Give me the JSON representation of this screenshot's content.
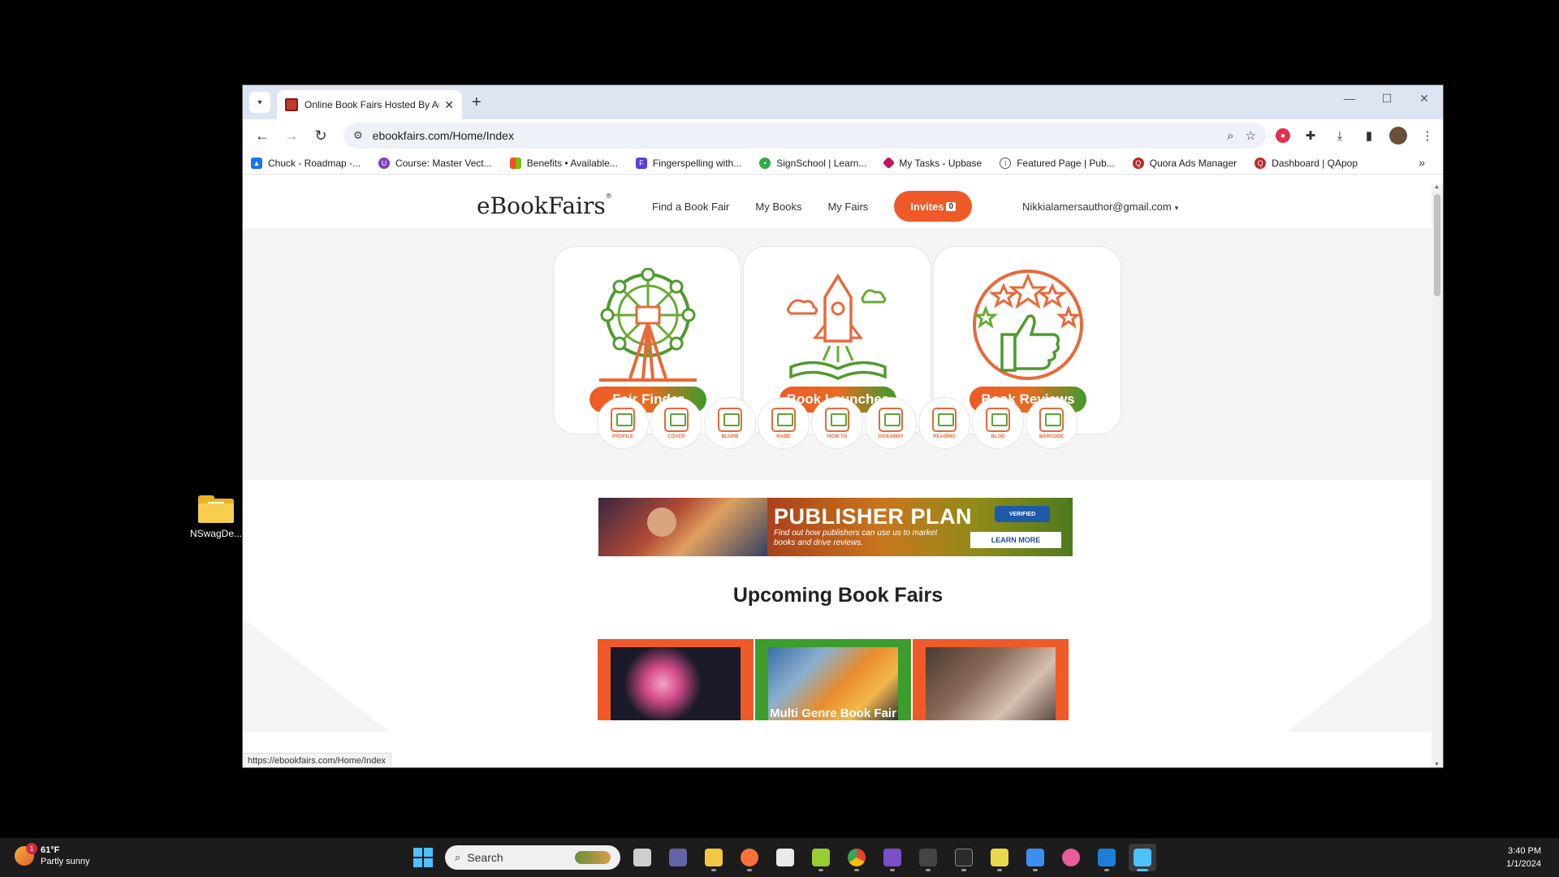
{
  "desktop": {
    "icons": [
      {
        "label": "NSwagDe..."
      }
    ]
  },
  "browser": {
    "tab": {
      "title": "Online Book Fairs Hosted By Au",
      "close": "✕"
    },
    "new_tab": "+",
    "window_controls": {
      "minimize": "—",
      "maximize": "☐",
      "close": "✕"
    },
    "toolbar": {
      "back": "←",
      "forward": "→",
      "reload": "↻"
    },
    "omnibox": {
      "url": "ebookfairs.com/Home/Index"
    },
    "bookmarks": [
      {
        "label": "Chuck - Roadmap -...",
        "icon": "triangle-icon",
        "color": "#1a73e8"
      },
      {
        "label": "Course: Master Vect...",
        "icon": "u-icon",
        "color": "#7b3fbf"
      },
      {
        "label": "Benefits • Available...",
        "icon": "microsoft-icon",
        "color": "#f25022"
      },
      {
        "label": "Fingerspelling with...",
        "icon": "f-icon",
        "color": "#5b3fd9"
      },
      {
        "label": "SignSchool | Learn...",
        "icon": "pin-icon",
        "color": "#2eaa4a"
      },
      {
        "label": "My Tasks - Upbase",
        "icon": "diamond-icon",
        "color": "#c2185b"
      },
      {
        "label": "Featured Page | Pub...",
        "icon": "circle-icon",
        "color": "#555555"
      },
      {
        "label": "Quora Ads Manager",
        "icon": "quora-icon",
        "color": "#b92b27"
      },
      {
        "label": "Dashboard | QApop",
        "icon": "quora-icon",
        "color": "#b92b27"
      }
    ],
    "bookmarks_more": "»",
    "status_url": "https://ebookfairs.com/Home/Index"
  },
  "site": {
    "logo": "eBookFairs",
    "logo_mark": "®",
    "nav": [
      "Find a Book Fair",
      "My Books",
      "My Fairs"
    ],
    "invites": {
      "label": "Invites",
      "count": "0"
    },
    "user_email": "Nikkialamersauthor@gmail.com",
    "user_caret": "▾",
    "features": [
      {
        "label": "Fair Finder",
        "icon": "ferris-wheel-icon"
      },
      {
        "label": "Book Launches",
        "icon": "rocket-book-icon"
      },
      {
        "label": "Book Reviews",
        "icon": "stars-thumbs-up-icon"
      }
    ],
    "tools": [
      {
        "label": "PROFILE"
      },
      {
        "label": "COVER"
      },
      {
        "label": "BLURB"
      },
      {
        "label": "NAME"
      },
      {
        "label": "HOW TO"
      },
      {
        "label": "GIVEAWAY"
      },
      {
        "label": "READING"
      },
      {
        "label": "BLOG"
      },
      {
        "label": "BARCODE"
      }
    ],
    "banner": {
      "title": "PUBLISHER PLAN",
      "subtitle": "Find out how publishers can use us to market books and drive reviews.",
      "cta": "LEARN MORE",
      "badge": "VERIFIED"
    },
    "section_title": "Upcoming Book Fairs",
    "fairs": [
      {
        "caption": "",
        "frame_color": "#ef5a28"
      },
      {
        "caption": "Multi Genre Book Fair",
        "frame_color": "#3c9c2c"
      },
      {
        "caption": "",
        "frame_color": "#ef5a28"
      }
    ],
    "accent_orange": "#ef5a28",
    "accent_green": "#3c9c2c"
  },
  "taskbar": {
    "weather": {
      "temp": "61°F",
      "desc": "Partly sunny",
      "badge": "1"
    },
    "search_placeholder": "Search",
    "apps": [
      {
        "name": "task-view-icon",
        "color": "#cfcfcf"
      },
      {
        "name": "teams-icon",
        "color": "#6264a7"
      },
      {
        "name": "file-explorer-icon",
        "color": "#f2c744"
      },
      {
        "name": "firefox-icon",
        "color": "#ff7139"
      },
      {
        "name": "inkscape-icon",
        "color": "#e9e9e9"
      },
      {
        "name": "notepad-plus-icon",
        "color": "#9acd32"
      },
      {
        "name": "chrome-icon",
        "color": "#34a853"
      },
      {
        "name": "visual-studio-icon",
        "color": "#7a4fc9"
      },
      {
        "name": "terminal-icon",
        "color": "#444444"
      },
      {
        "name": "cmd-icon",
        "color": "#2b2b2b"
      },
      {
        "name": "sticky-app-icon",
        "color": "#e8d94a"
      },
      {
        "name": "notepad-icon",
        "color": "#3c8ff0"
      },
      {
        "name": "edge-dev-icon",
        "color": "#e85d9a"
      },
      {
        "name": "trello-icon",
        "color": "#1c7ed6"
      },
      {
        "name": "active-window-icon",
        "color": "#4cc2ff"
      }
    ],
    "time": "3:40 PM",
    "date": "1/1/2024"
  }
}
